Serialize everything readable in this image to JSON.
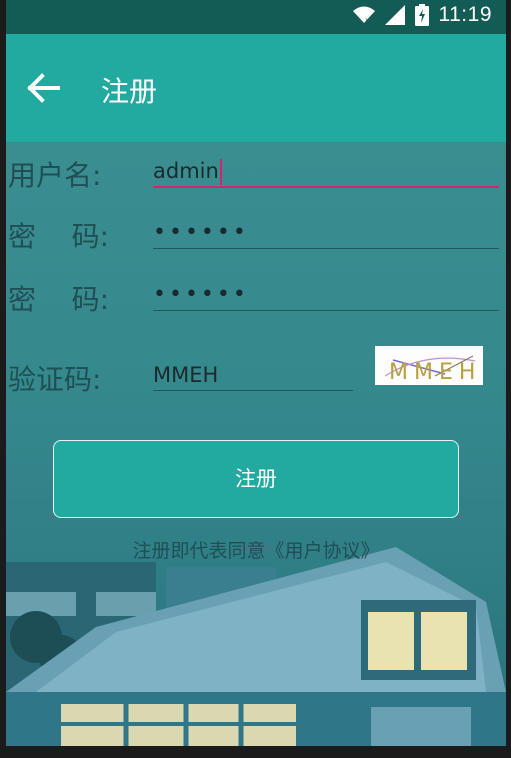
{
  "status_bar": {
    "time": "11:19",
    "icons": [
      "wifi-icon",
      "signal-icon",
      "battery-charging-icon"
    ]
  },
  "app_bar": {
    "title": "注册",
    "back_icon": "arrow-left-icon"
  },
  "form": {
    "username": {
      "label": "用户名:",
      "value": "admin"
    },
    "password": {
      "label": "密    码:",
      "value": "••••••"
    },
    "confirm_password": {
      "label": "密    码:",
      "value": "••••••"
    },
    "captcha": {
      "label": "验证码:",
      "value": "MMEH",
      "image_text": "MMEH"
    }
  },
  "register_button": {
    "label": "注册"
  },
  "agreement": {
    "text": "注册即代表同意《用户协议》"
  },
  "colors": {
    "accent": "#23aaa0",
    "status_bar": "#135c56",
    "active_underline": "#d4236f"
  }
}
